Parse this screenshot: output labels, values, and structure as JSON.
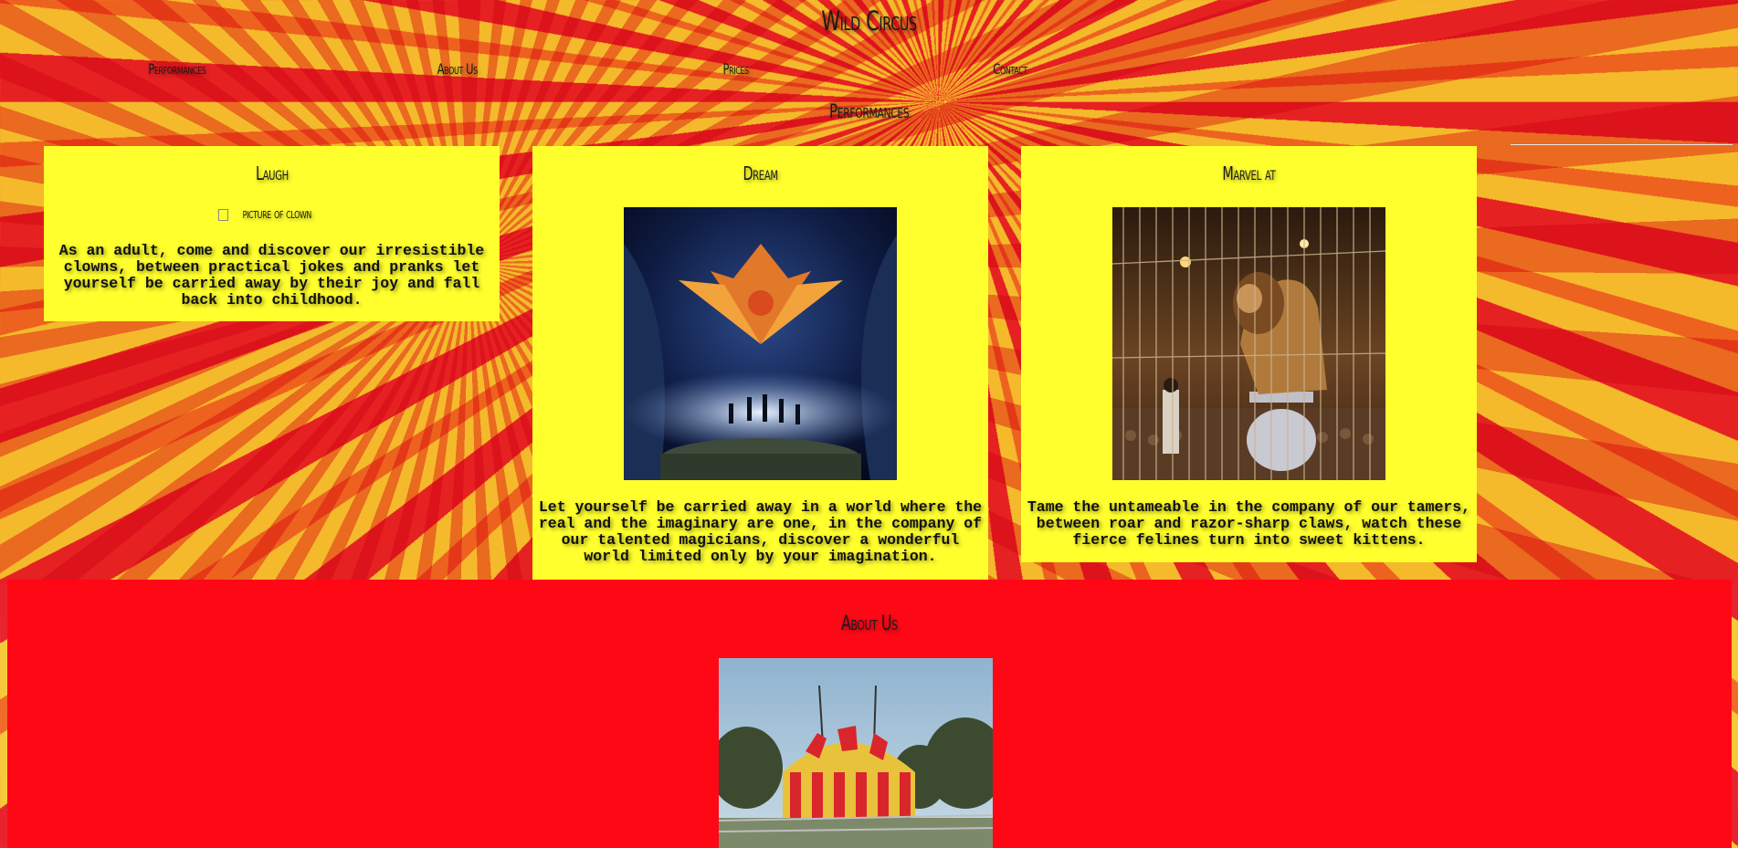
{
  "site": {
    "title": "Wild Circus"
  },
  "nav": {
    "items": [
      {
        "label": "Performances"
      },
      {
        "label": "About Us"
      },
      {
        "label": "Prices"
      },
      {
        "label": "Contact"
      }
    ]
  },
  "performances": {
    "title": "Performances",
    "cards": [
      {
        "title": "Laugh",
        "image_alt": "picture of clown",
        "text": "As an adult, come and discover our irresistible clowns, between practical jokes and pranks let yourself be carried away by their joy and fall back into childhood."
      },
      {
        "title": "Dream",
        "text": "Let yourself be carried away in a world where the real and the imaginary are one, in the company of our talented magicians, discover a wonderful world limited only by your imagination."
      },
      {
        "title": "Marvel at",
        "text": "Tame the untameable in the company of our tamers, between roar and razor-sharp claws, watch these fierce felines turn into sweet kittens."
      }
    ]
  },
  "about": {
    "title": "About Us"
  },
  "colors": {
    "card_bg": "#ffff2e",
    "about_bg": "#ff0816",
    "stripe_red": "#e8232e",
    "stripe_yellow": "#f7c93a"
  }
}
